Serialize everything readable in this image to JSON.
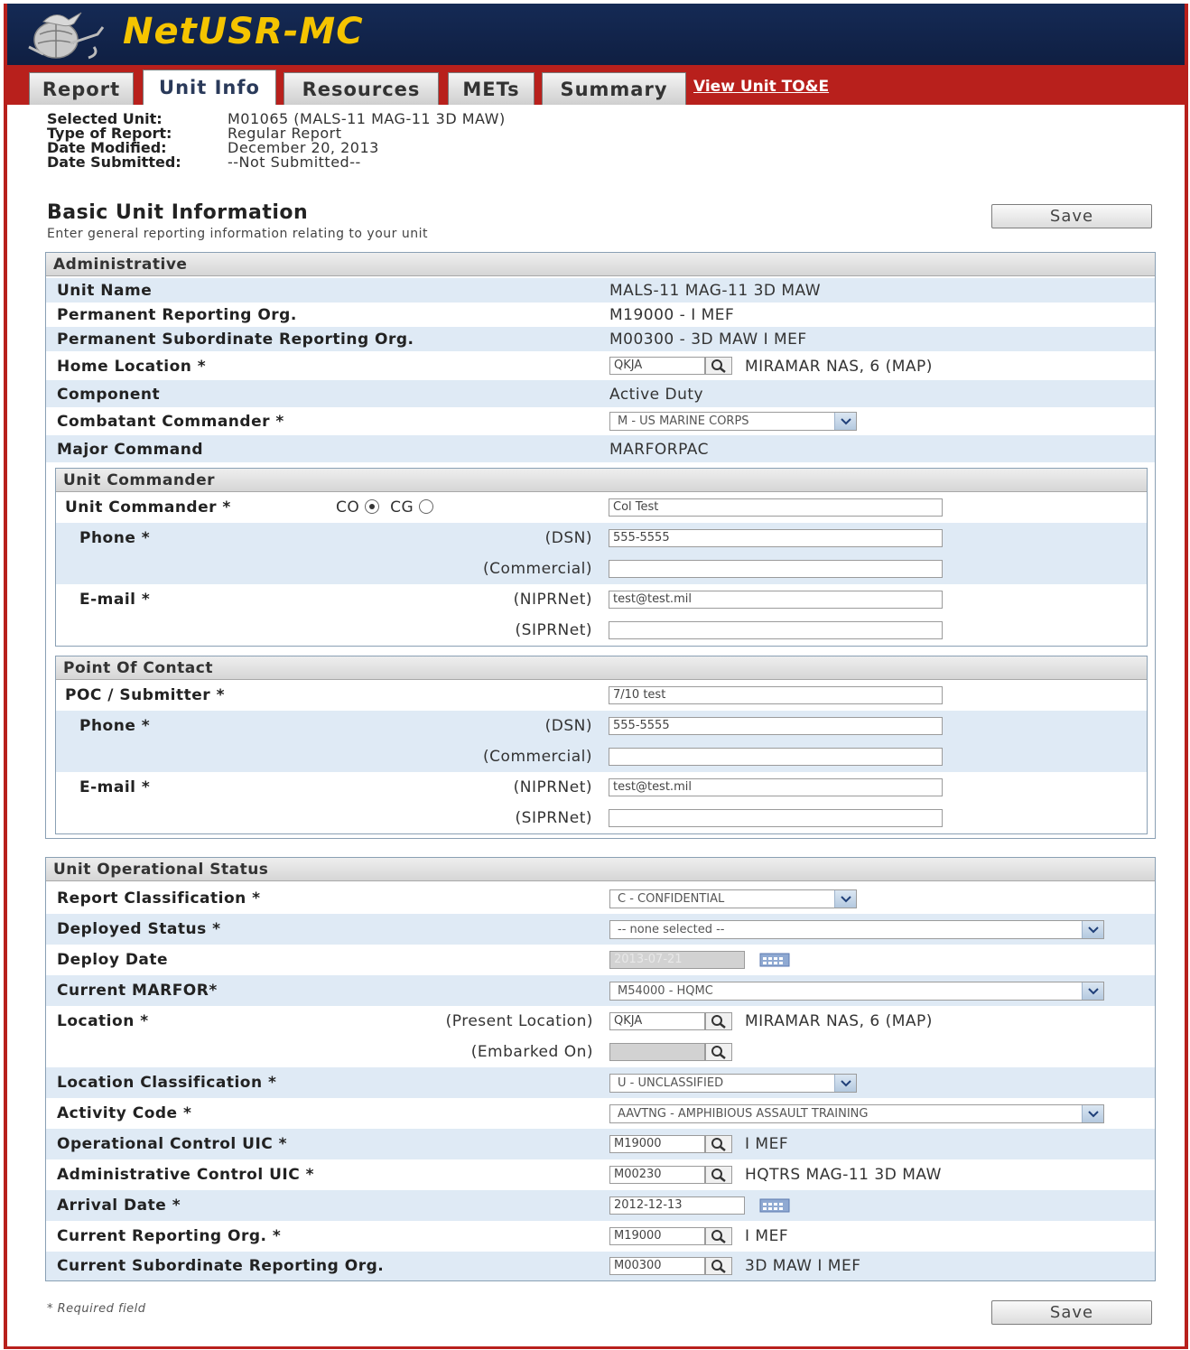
{
  "app": {
    "title": "NetUSR-MC"
  },
  "tabs": [
    {
      "label": "Report"
    },
    {
      "label": "Unit Info",
      "active": true
    },
    {
      "label": "Resources"
    },
    {
      "label": "METs"
    },
    {
      "label": "Summary"
    }
  ],
  "tab_link": "View Unit TO&E",
  "meta": {
    "selected_unit_label": "Selected Unit:",
    "selected_unit": "M01065 (MALS-11 MAG-11 3D MAW)",
    "report_type_label": "Type of Report:",
    "report_type": "Regular Report",
    "date_modified_label": "Date Modified:",
    "date_modified": "December 20, 2013",
    "date_submitted_label": "Date Submitted:",
    "date_submitted": "--Not Submitted--"
  },
  "section": {
    "title": "Basic Unit Information",
    "subtitle": "Enter general reporting information relating to your unit",
    "save_label": "Save"
  },
  "admin": {
    "title": "Administrative",
    "unit_name_label": "Unit Name",
    "unit_name": "MALS-11 MAG-11 3D MAW",
    "perm_org_label": "Permanent Reporting Org.",
    "perm_org": "M19000 - I MEF",
    "perm_sub_org_label": "Permanent Subordinate Reporting Org.",
    "perm_sub_org": "M00300 - 3D MAW I MEF",
    "home_location_label": "Home Location *",
    "home_location_code": "QKJA",
    "home_location_name": "MIRAMAR NAS, 6 (MAP)",
    "component_label": "Component",
    "component": "Active Duty",
    "combatant_label": "Combatant Commander *",
    "combatant": "M - US MARINE CORPS",
    "major_command_label": "Major Command",
    "major_command": "MARFORPAC"
  },
  "unit_commander": {
    "title": "Unit Commander",
    "label": "Unit Commander *",
    "co_label": "CO",
    "cg_label": "CG",
    "name": "Col Test",
    "phone_label": "Phone *",
    "dsn_label": "(DSN)",
    "dsn": "555-5555",
    "commercial_label": "(Commercial)",
    "commercial": "",
    "email_label": "E-mail *",
    "nipr_label": "(NIPRNet)",
    "nipr": "test@test.mil",
    "sipr_label": "(SIPRNet)",
    "sipr": ""
  },
  "poc": {
    "title": "Point Of Contact",
    "label": "POC / Submitter *",
    "name": "7/10 test",
    "phone_label": "Phone *",
    "dsn_label": "(DSN)",
    "dsn": "555-5555",
    "commercial_label": "(Commercial)",
    "commercial": "",
    "email_label": "E-mail *",
    "nipr_label": "(NIPRNet)",
    "nipr": "test@test.mil",
    "sipr_label": "(SIPRNet)",
    "sipr": ""
  },
  "ops": {
    "title": "Unit Operational Status",
    "report_class_label": "Report Classification *",
    "report_class": "C - CONFIDENTIAL",
    "deployed_label": "Deployed Status *",
    "deployed": "-- none selected --",
    "deploy_date_label": "Deploy Date",
    "deploy_date": "2013-07-21",
    "marfor_label": "Current MARFOR*",
    "marfor": "M54000 - HQMC",
    "location_label": "Location *",
    "present_label": "(Present Location)",
    "present_code": "QKJA",
    "present_name": "MIRAMAR NAS, 6 (MAP)",
    "embarked_label": "(Embarked On)",
    "embarked": "",
    "loc_class_label": "Location Classification *",
    "loc_class": "U - UNCLASSIFIED",
    "activity_label": "Activity Code *",
    "activity": "AAVTNG - AMPHIBIOUS ASSAULT TRAINING",
    "opcon_label": "Operational Control UIC *",
    "opcon_code": "M19000",
    "opcon_name": "I MEF",
    "adcon_label": "Administrative Control UIC *",
    "adcon_code": "M00230",
    "adcon_name": "HQTRS MAG-11 3D MAW",
    "arrival_label": "Arrival Date *",
    "arrival": "2012-12-13",
    "cur_org_label": "Current Reporting Org. *",
    "cur_org_code": "M19000",
    "cur_org_name": "I MEF",
    "cur_sub_label": "Current Subordinate Reporting Org.",
    "cur_sub_code": "M00300",
    "cur_sub_name": "3D MAW I MEF"
  },
  "footer": {
    "required_note": "* Required field"
  }
}
